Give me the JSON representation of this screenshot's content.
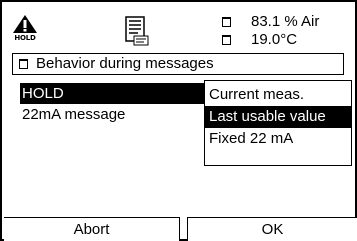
{
  "status": {
    "hold_label": "HOLD",
    "doc_icon": "document-icon",
    "measurements": [
      {
        "value": "83.1 % Air"
      },
      {
        "value": "19.0°C"
      }
    ]
  },
  "title": "Behavior during messages",
  "list": {
    "items": [
      {
        "label": "HOLD",
        "selected": true
      },
      {
        "label": "22mA message",
        "selected": false
      }
    ]
  },
  "dropdown": {
    "options": [
      {
        "label": "Current meas.",
        "selected": false
      },
      {
        "label": "Last usable value",
        "selected": true
      },
      {
        "label": "Fixed  22 mA",
        "selected": false
      }
    ]
  },
  "softkeys": {
    "left_label": "Abort",
    "right_label": "OK"
  },
  "colors": {
    "foreground": "#000000",
    "background": "#ffffff"
  }
}
